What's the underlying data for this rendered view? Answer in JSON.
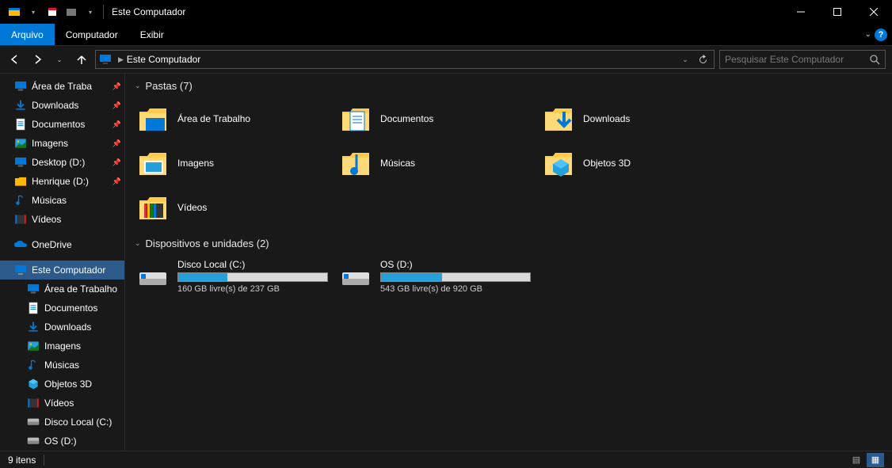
{
  "title": "Este Computador",
  "ribbon": {
    "file": "Arquivo",
    "tabs": [
      "Computador",
      "Exibir"
    ]
  },
  "address": {
    "path": "Este Computador",
    "search_placeholder": "Pesquisar Este Computador"
  },
  "sidebar": {
    "quick": [
      {
        "label": "Área de Traba",
        "icon": "desktop",
        "pinned": true
      },
      {
        "label": "Downloads",
        "icon": "download",
        "pinned": true
      },
      {
        "label": "Documentos",
        "icon": "document",
        "pinned": true
      },
      {
        "label": "Imagens",
        "icon": "pictures",
        "pinned": true
      },
      {
        "label": "Desktop (D:)",
        "icon": "desktop",
        "pinned": true
      },
      {
        "label": "Henrique (D:)",
        "icon": "folder",
        "pinned": true
      },
      {
        "label": "Músicas",
        "icon": "music",
        "pinned": false
      },
      {
        "label": "Vídeos",
        "icon": "videos",
        "pinned": false
      }
    ],
    "onedrive": "OneDrive",
    "thispc": {
      "label": "Este Computador",
      "children": [
        {
          "label": "Área de Trabalho",
          "icon": "desktop"
        },
        {
          "label": "Documentos",
          "icon": "document"
        },
        {
          "label": "Downloads",
          "icon": "download"
        },
        {
          "label": "Imagens",
          "icon": "pictures"
        },
        {
          "label": "Músicas",
          "icon": "music"
        },
        {
          "label": "Objetos 3D",
          "icon": "objects3d"
        },
        {
          "label": "Vídeos",
          "icon": "videos"
        },
        {
          "label": "Disco Local (C:)",
          "icon": "drive"
        },
        {
          "label": "OS (D:)",
          "icon": "drive"
        }
      ]
    }
  },
  "groups": {
    "folders": {
      "header": "Pastas (7)",
      "items": [
        {
          "label": "Área de Trabalho",
          "icon": "desktop"
        },
        {
          "label": "Documentos",
          "icon": "document"
        },
        {
          "label": "Downloads",
          "icon": "download"
        },
        {
          "label": "Imagens",
          "icon": "pictures"
        },
        {
          "label": "Músicas",
          "icon": "music"
        },
        {
          "label": "Objetos 3D",
          "icon": "objects3d"
        },
        {
          "label": "Vídeos",
          "icon": "videos"
        }
      ]
    },
    "drives": {
      "header": "Dispositivos e unidades (2)",
      "items": [
        {
          "label": "Disco Local (C:)",
          "text": "160 GB livre(s) de 237 GB",
          "fill_pct": 33
        },
        {
          "label": "OS (D:)",
          "text": "543 GB livre(s) de 920 GB",
          "fill_pct": 41
        }
      ]
    }
  },
  "status": {
    "items": "9 itens"
  }
}
